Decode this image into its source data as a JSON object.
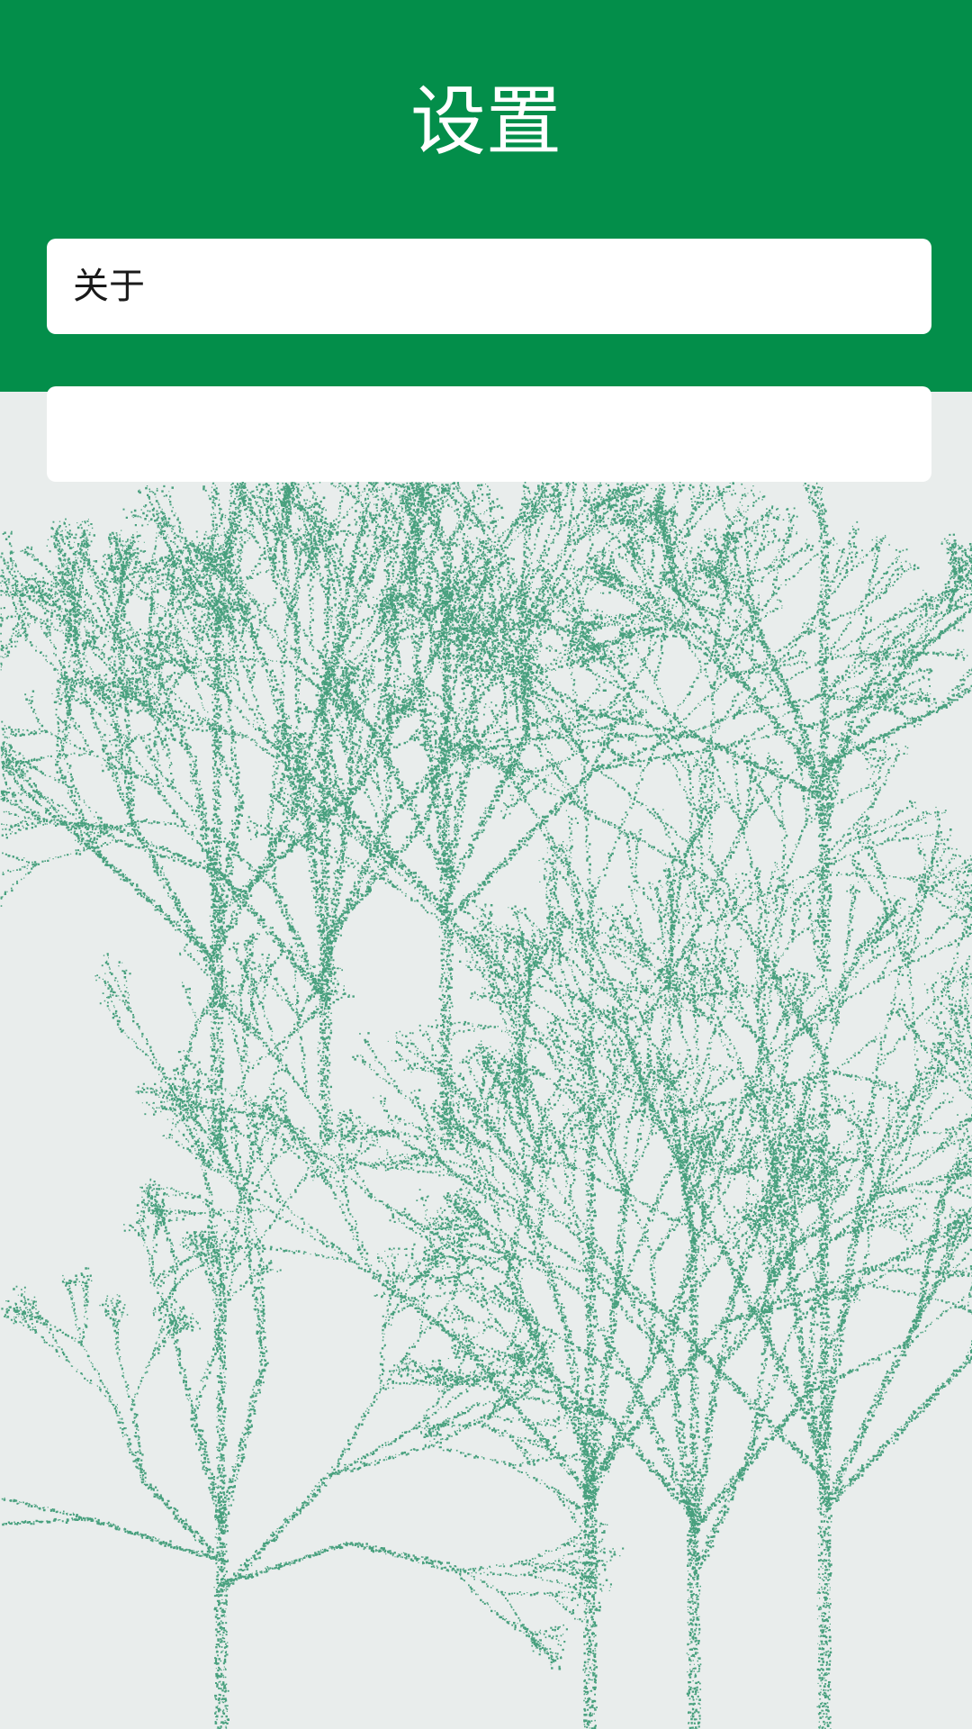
{
  "header": {
    "title": "设置",
    "background_color": "#038e4a"
  },
  "settings": {
    "items": [
      {
        "label": "关于"
      },
      {
        "label": ""
      }
    ]
  },
  "background": {
    "illustration": "tree-illustration",
    "color": "#e9edec",
    "ink_color": "#12855a"
  }
}
